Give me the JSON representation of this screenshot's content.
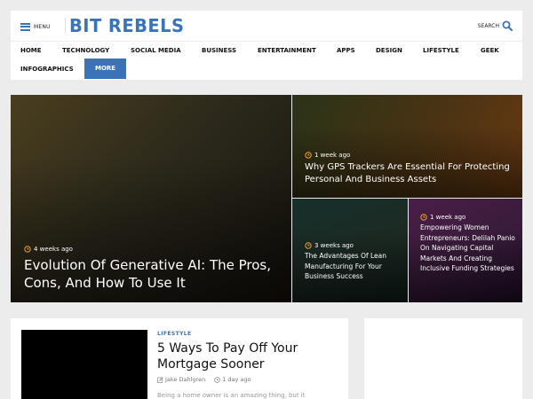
{
  "header": {
    "menu_label": "MENU",
    "logo_text": "BIT REBELS",
    "search_label": "SEARCH",
    "nav": [
      {
        "label": "HOME"
      },
      {
        "label": "TECHNOLOGY"
      },
      {
        "label": "SOCIAL MEDIA"
      },
      {
        "label": "BUSINESS"
      },
      {
        "label": "ENTERTAINMENT"
      },
      {
        "label": "APPS"
      },
      {
        "label": "DESIGN"
      },
      {
        "label": "LIFESTYLE"
      },
      {
        "label": "GEEK"
      },
      {
        "label": "INFOGRAPHICS"
      },
      {
        "label": "MORE"
      }
    ]
  },
  "featured": {
    "main": {
      "time": "4 weeks ago",
      "title": "Evolution Of Generative AI: The Pros, Cons, And How To Use It"
    },
    "top": {
      "time": "1 week ago",
      "title": "Why GPS Trackers Are Essential For Protecting Personal And Business Assets"
    },
    "bottom_left": {
      "time": "3 weeks ago",
      "title": "The Advantages Of Lean Manufacturing For Your Business Success"
    },
    "bottom_right": {
      "time": "1 week ago",
      "title": "Empowering Women Entrepreneurs: Delilah Panio On Navigating Capital Markets And Creating Inclusive Funding Strategies"
    }
  },
  "article": {
    "category": "LIFESTYLE",
    "title": "5 Ways To Pay Off Your Mortgage Sooner",
    "author": "Jake Dahlgren",
    "time": "1 day ago",
    "excerpt": "Being a home owner is an amazing thing, but it"
  },
  "colors": {
    "accent": "#3b73b9",
    "clock": "#f0a020"
  }
}
